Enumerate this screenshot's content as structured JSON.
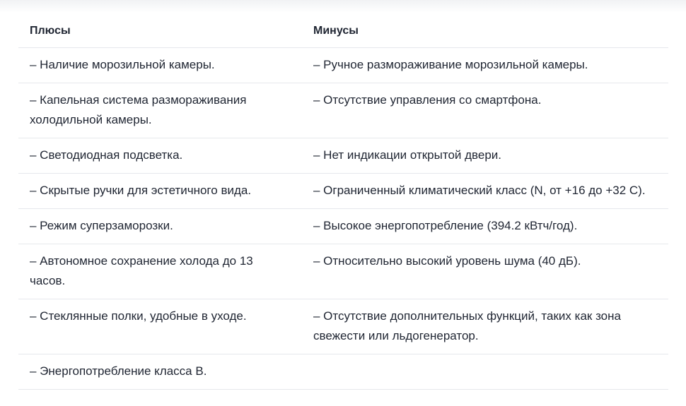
{
  "table": {
    "headers": {
      "pros": "Плюсы",
      "cons": "Минусы"
    },
    "rows": [
      {
        "pro": "– Наличие морозильной камеры.",
        "con": "– Ручное размораживание морозильной камеры."
      },
      {
        "pro": "– Капельная система размораживания холодильной камеры.",
        "con": "– Отсутствие управления со смартфона."
      },
      {
        "pro": "– Светодиодная подсветка.",
        "con": "– Нет индикации открытой двери."
      },
      {
        "pro": "– Скрытые ручки для эстетичного вида.",
        "con": "– Ограниченный климатический класс (N, от +16 до +32 С)."
      },
      {
        "pro": "– Режим суперзаморозки.",
        "con": "– Высокое энергопотребление (394.2 кВтч/год)."
      },
      {
        "pro": "– Автономное сохранение холода до 13 часов.",
        "con": "– Относительно высокий уровень шума (40 дБ)."
      },
      {
        "pro": "– Стеклянные полки, удобные в уходе.",
        "con": "– Отсутствие дополнительных функций, таких как зона свежести или льдогенератор."
      },
      {
        "pro": "– Энергопотребление класса В.",
        "con": ""
      }
    ]
  }
}
